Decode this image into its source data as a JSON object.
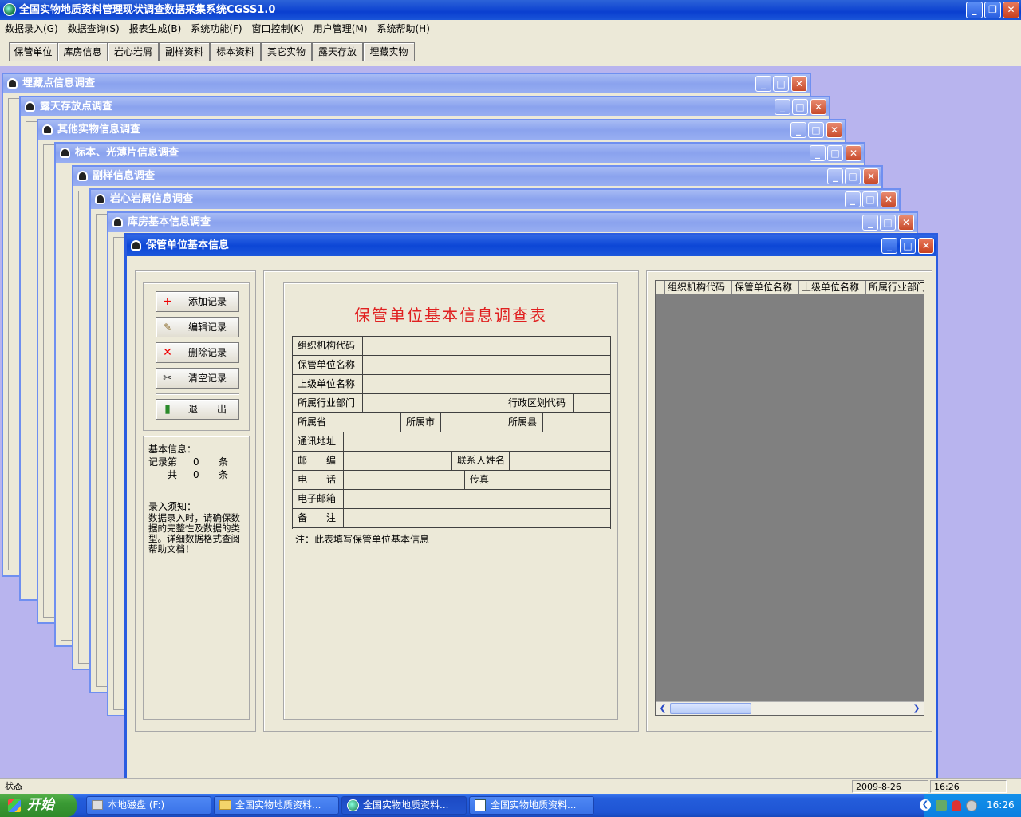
{
  "app": {
    "title": "全国实物地质资料管理现状调查数据采集系统CGSS1.0"
  },
  "menu": [
    "数据录入(G)",
    "数据查询(S)",
    "报表生成(B)",
    "系统功能(F)",
    "窗口控制(K)",
    "用户管理(M)",
    "系统帮助(H)"
  ],
  "toolbar": [
    "保管单位",
    "库房信息",
    "岩心岩屑",
    "副样资料",
    "标本资料",
    "其它实物",
    "露天存放",
    "埋藏实物"
  ],
  "child_windows": [
    "埋藏点信息调查",
    "露天存放点调查",
    "其他实物信息调查",
    "标本、光薄片信息调查",
    "副样信息调查",
    "岩心岩屑信息调查",
    "库房基本信息调查"
  ],
  "active_window": {
    "title": "保管单位基本信息",
    "buttons": {
      "add": "添加记录",
      "edit": "编辑记录",
      "delete": "删除记录",
      "clear": "清空记录",
      "exit": "退　　出"
    },
    "info": {
      "heading": "基本信息：",
      "record_label": "记录第",
      "record_no": "0",
      "unit": "条",
      "total_label": "共",
      "total": "0",
      "notice_heading": "录入须知：",
      "notice_text": "数据录入时，请确保数据的完整性及数据的类型。详细数据格式查阅帮助文档！"
    },
    "form": {
      "title": "保管单位基本信息调查表",
      "org_code": "组织机构代码",
      "unit_name": "保管单位名称",
      "parent_name": "上级单位名称",
      "industry": "所属行业部门",
      "region_code": "行政区划代码",
      "province": "所属省",
      "city": "所属市",
      "county": "所属县",
      "address": "通讯地址",
      "postcode": "邮　　编",
      "contact": "联系人姓名",
      "phone": "电　　话",
      "fax": "传真",
      "email": "电子邮箱",
      "remark": "备　　注",
      "note": "注：此表填写保管单位基本信息"
    },
    "grid_columns": [
      "组织机构代码",
      "保管单位名称",
      "上级单位名称",
      "所属行业部门"
    ]
  },
  "statusbar": {
    "status": "状态",
    "date": "2009-8-26",
    "time": "16:26"
  },
  "taskbar": {
    "start": "开始",
    "tasks": [
      "本地磁盘 (F:)",
      "全国实物地质资料...",
      "全国实物地质资料...",
      "全国实物地质资料..."
    ],
    "clock": "16:26"
  }
}
